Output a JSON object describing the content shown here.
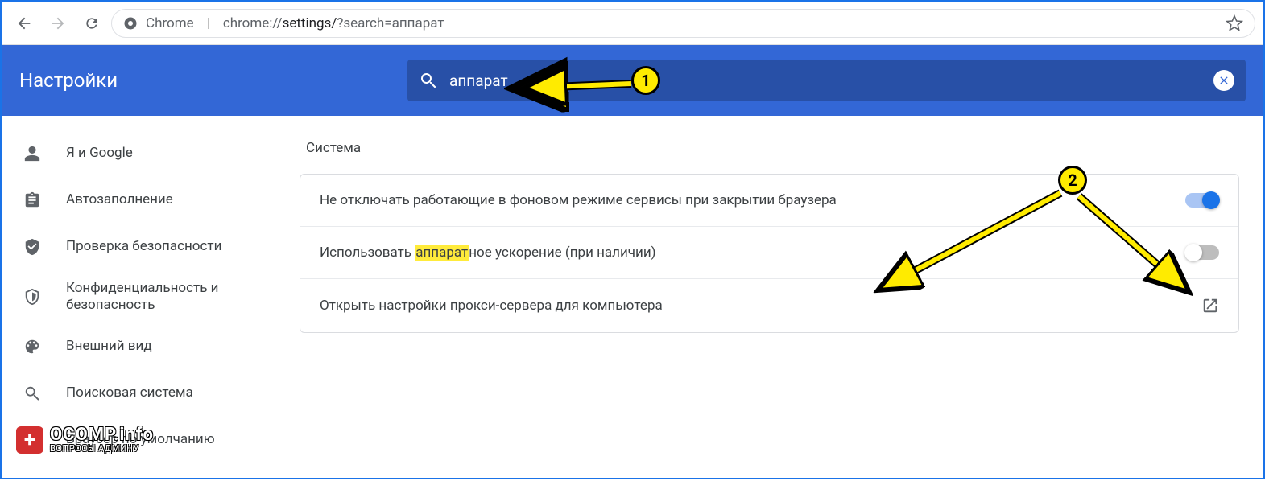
{
  "browser": {
    "label": "Chrome",
    "url_prefix": "chrome://",
    "url_path": "settings/",
    "url_query": "?search=аппарат"
  },
  "header": {
    "title": "Настройки",
    "search_value": "аппарат"
  },
  "sidebar": {
    "items": [
      {
        "id": "you-and-google",
        "icon": "person",
        "label": "Я и Google"
      },
      {
        "id": "autofill",
        "icon": "assignment",
        "label": "Автозаполнение"
      },
      {
        "id": "safety-check",
        "icon": "verified",
        "label": "Проверка безопасности"
      },
      {
        "id": "privacy",
        "icon": "security",
        "label": "Конфиденциальность и безопасность"
      },
      {
        "id": "appearance",
        "icon": "palette",
        "label": "Внешний вид"
      },
      {
        "id": "search-engine",
        "icon": "search",
        "label": "Поисковая система"
      },
      {
        "id": "default-browser",
        "icon": "browser",
        "label": "Браузер по умолчанию"
      }
    ]
  },
  "content": {
    "section_title": "Система",
    "rows": [
      {
        "label_plain": "Не отключать работающие в фоновом режиме сервисы при закрытии браузера",
        "type": "toggle",
        "value": true
      },
      {
        "label_pre": "Использовать ",
        "label_hl": "аппарат",
        "label_post": "ное ускорение (при наличии)",
        "type": "toggle",
        "value": false
      },
      {
        "label_plain": "Открыть настройки прокси-сервера для компьютера",
        "type": "link"
      }
    ]
  },
  "annotations": {
    "marker1": "1",
    "marker2": "2"
  },
  "watermark": {
    "text": "OCOMP.info",
    "sub": "ВОПРОСЫ АДМИНУ"
  }
}
